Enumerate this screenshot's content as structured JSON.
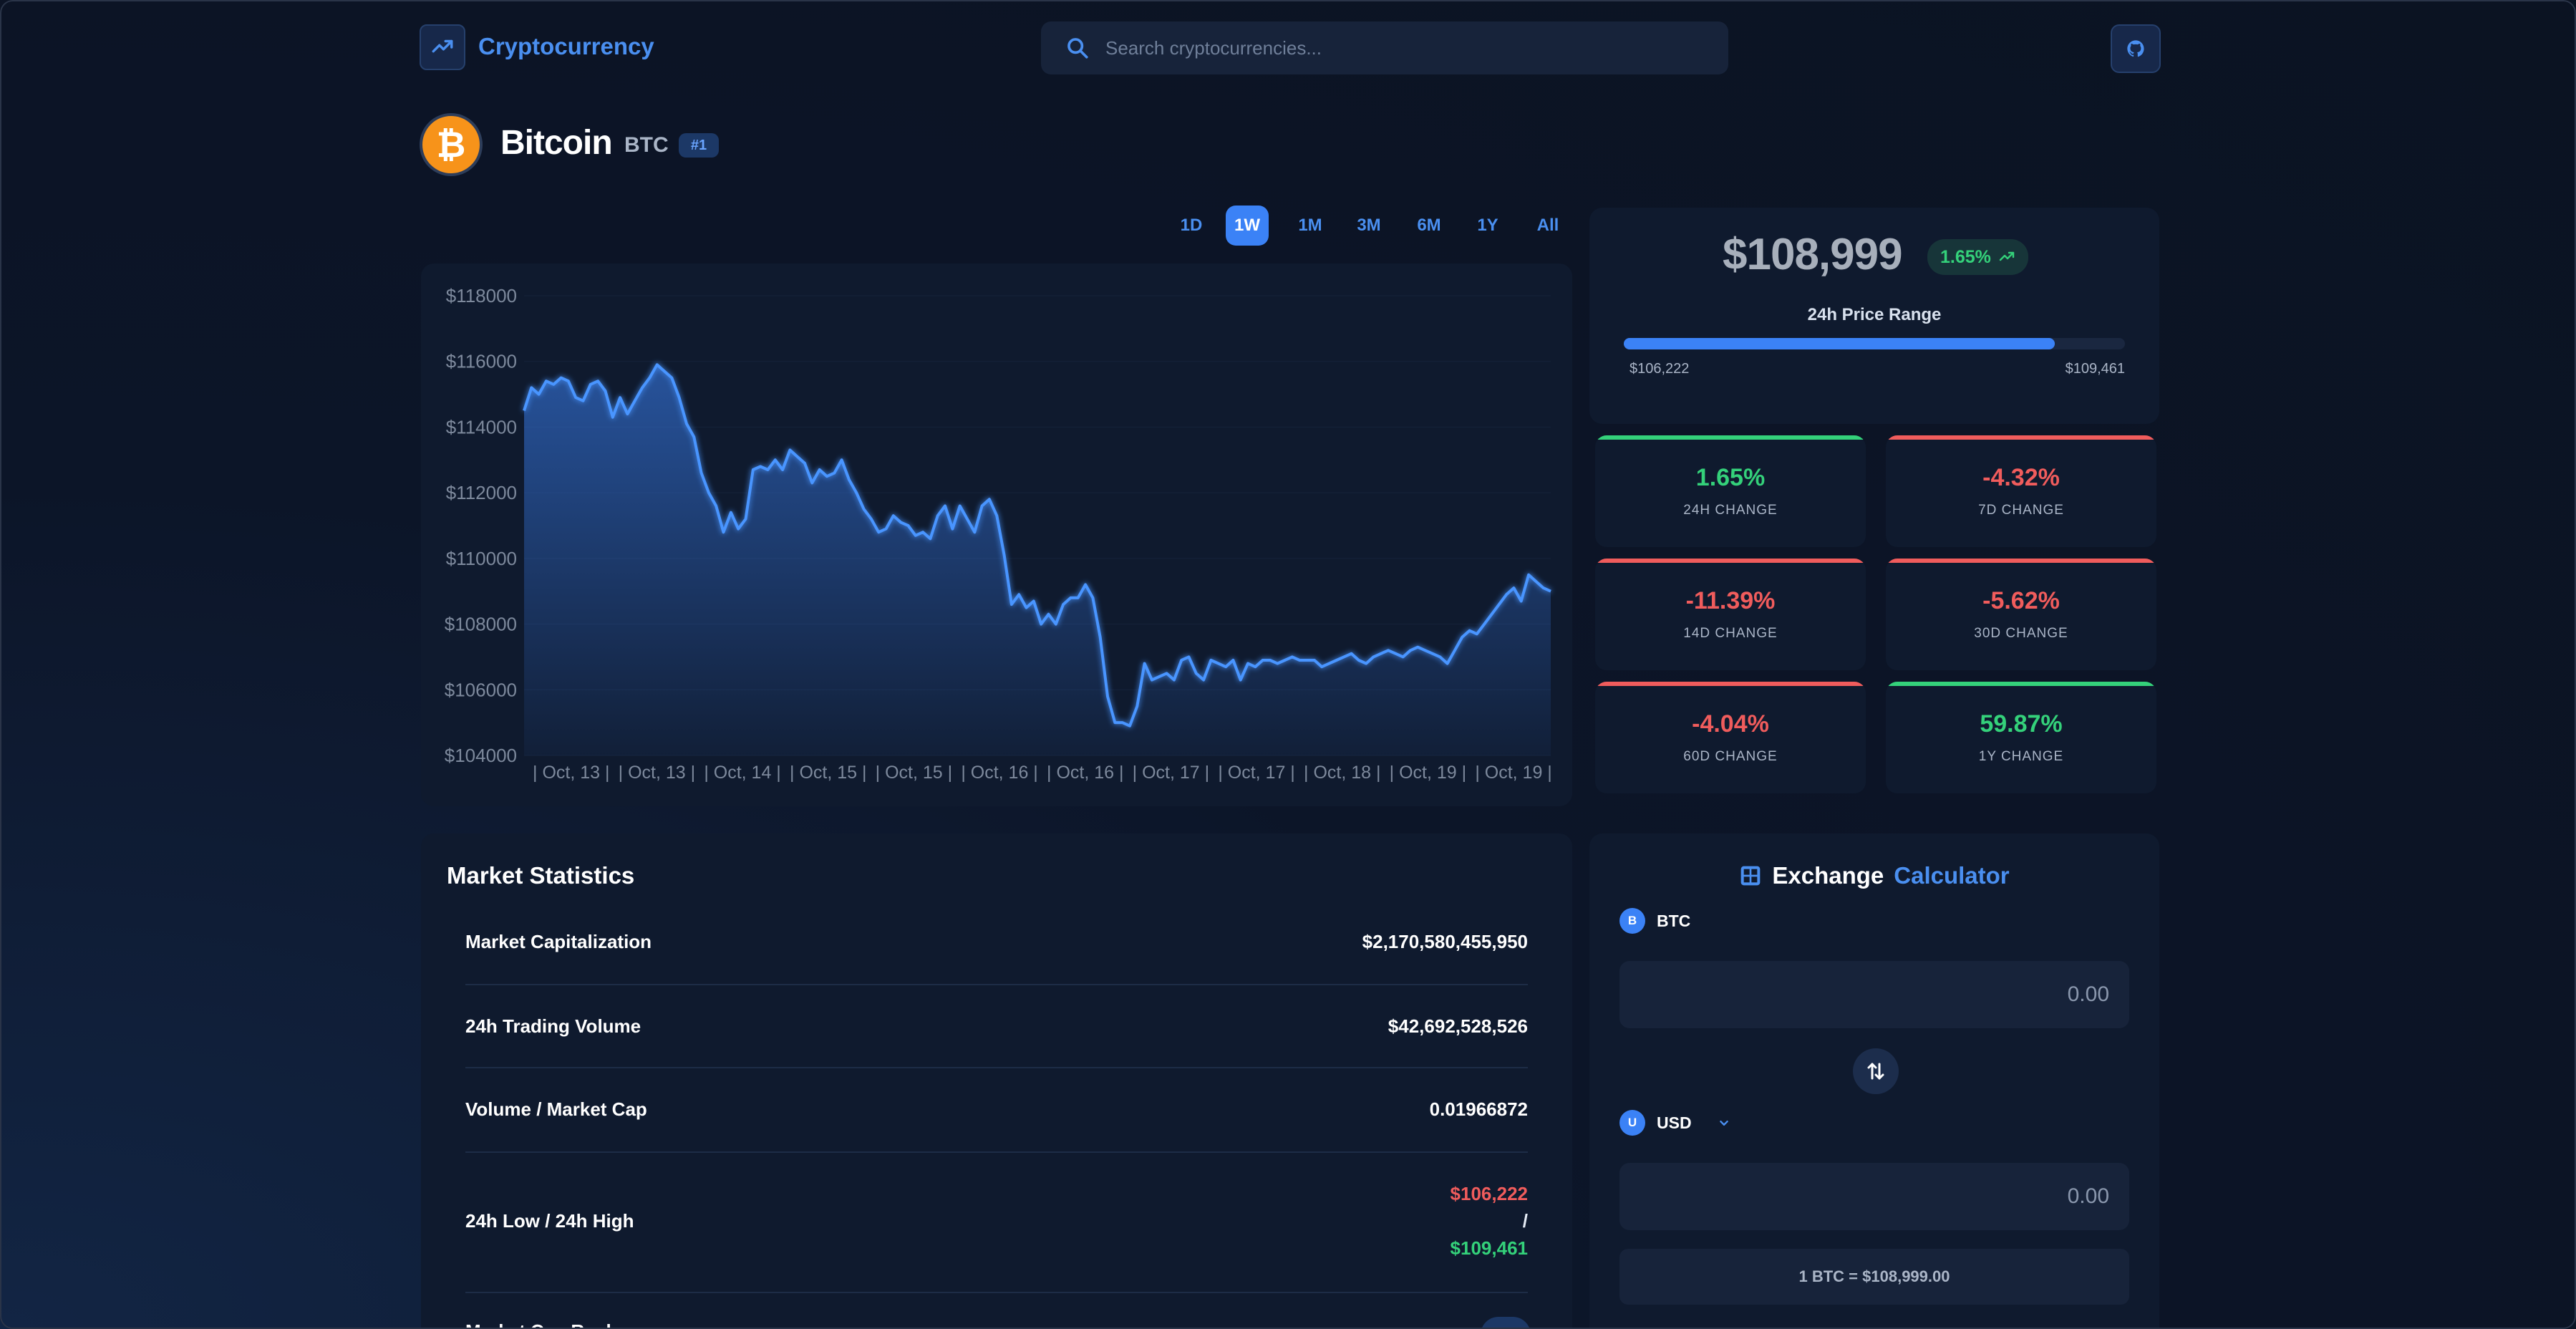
{
  "header": {
    "brand": "Cryptocurrency",
    "search_placeholder": "Search cryptocurrencies..."
  },
  "coin": {
    "name": "Bitcoin",
    "symbol": "BTC",
    "rank": "#1",
    "logo_glyph": "₿"
  },
  "ranges": [
    {
      "label": "1D",
      "active": false
    },
    {
      "label": "1W",
      "active": true
    },
    {
      "label": "1M",
      "active": false
    },
    {
      "label": "3M",
      "active": false
    },
    {
      "label": "6M",
      "active": false
    },
    {
      "label": "1Y",
      "active": false
    },
    {
      "label": "All",
      "active": false
    }
  ],
  "price_card": {
    "price": "$108,999",
    "change_24h": "1.65%",
    "range_label": "24h Price Range",
    "low": "$106,222",
    "high": "$109,461",
    "position_fraction": 0.86
  },
  "changes": [
    {
      "value": "1.65%",
      "label": "24H CHANGE",
      "positive": true
    },
    {
      "value": "-4.32%",
      "label": "7D CHANGE",
      "positive": false
    },
    {
      "value": "-11.39%",
      "label": "14D CHANGE",
      "positive": false
    },
    {
      "value": "-5.62%",
      "label": "30D CHANGE",
      "positive": false
    },
    {
      "value": "-4.04%",
      "label": "60D CHANGE",
      "positive": false
    },
    {
      "value": "59.87%",
      "label": "1Y CHANGE",
      "positive": true
    }
  ],
  "chart_data": {
    "type": "area",
    "ylim": [
      104000,
      118000
    ],
    "y_ticks": [
      "$118000",
      "$116000",
      "$114000",
      "$112000",
      "$110000",
      "$108000",
      "$106000",
      "$104000"
    ],
    "x_tick_labels": [
      "| Oct, 13 |",
      "| Oct, 13 |",
      "| Oct, 14 |",
      "| Oct, 15 |",
      "| Oct, 15 |",
      "| Oct, 16 |",
      "| Oct, 16 |",
      "| Oct, 17 |",
      "| Oct, 17 |",
      "| Oct, 18 |",
      "| Oct, 19 |",
      "| Oct, 19 |"
    ],
    "series": [
      {
        "values": [
          114500,
          115200,
          115000,
          115400,
          115300,
          115500,
          115400,
          114900,
          114800,
          115300,
          115400,
          115100,
          114300,
          114900,
          114400,
          114800,
          115200,
          115500,
          115900,
          115700,
          115500,
          114900,
          114100,
          113700,
          112600,
          112000,
          111600,
          110800,
          111400,
          110900,
          111200,
          112700,
          112800,
          112700,
          113000,
          112700,
          113300,
          113100,
          112900,
          112300,
          112700,
          112500,
          112600,
          113000,
          112400,
          112000,
          111500,
          111200,
          110800,
          110900,
          111300,
          111100,
          111000,
          110700,
          110800,
          110600,
          111300,
          111600,
          110900,
          111600,
          111200,
          110800,
          111600,
          111800,
          111300,
          110100,
          108600,
          108900,
          108500,
          108700,
          108000,
          108300,
          108000,
          108600,
          108800,
          108800,
          109200,
          108800,
          107600,
          105800,
          105000,
          105000,
          104900,
          105500,
          106800,
          106300,
          106400,
          106500,
          106300,
          106900,
          107000,
          106500,
          106300,
          106900,
          106800,
          106700,
          106900,
          106300,
          106800,
          106700,
          106900,
          106900,
          106800,
          106900,
          107000,
          106900,
          106900,
          106900,
          106700,
          106800,
          106900,
          107000,
          107100,
          106900,
          106800,
          107000,
          107100,
          107200,
          107100,
          107000,
          107200,
          107300,
          107200,
          107100,
          107000,
          106800,
          107200,
          107600,
          107800,
          107700,
          108000,
          108300,
          108600,
          108900,
          109100,
          108700,
          109500,
          109300,
          109100,
          109000
        ]
      }
    ]
  },
  "market_stats": {
    "title": "Market Statistics",
    "rows": [
      {
        "label": "Market Capitalization",
        "value": "$2,170,580,455,950"
      },
      {
        "label": "24h Trading Volume",
        "value": "$42,692,528,526"
      },
      {
        "label": "Volume / Market Cap",
        "value": "0.01966872"
      }
    ],
    "lowhigh": {
      "label": "24h Low / 24h High",
      "low": "$106,222",
      "separator": "/",
      "high": "$109,461"
    },
    "cut_label": "Market Cap Rank"
  },
  "calculator": {
    "title_main": "Exchange",
    "title_accent": "Calculator",
    "from_symbol": "BTC",
    "from_initial": "B",
    "to_symbol": "USD",
    "to_initial": "U",
    "from_placeholder": "0.00",
    "to_placeholder": "0.00",
    "rate": "1 BTC = $108,999.00"
  },
  "colors": {
    "accent": "#3b82f6",
    "positive": "#34d17a",
    "negative": "#f05c5c",
    "bitcoin": "#f7931a"
  }
}
